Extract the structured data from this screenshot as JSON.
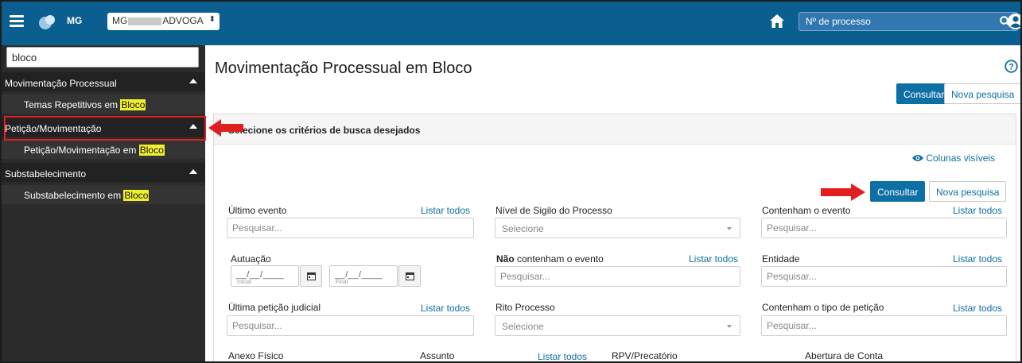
{
  "header": {
    "state": "MG",
    "user_select": {
      "prefix": "MG",
      "suffix": "ADVOGA"
    },
    "process_search_placeholder": "Nº de processo"
  },
  "sidebar": {
    "search_value": "bloco",
    "groups": [
      {
        "label": "Movimentação Processual",
        "items": [
          {
            "text": "Temas Repetitivos em ",
            "highlight": "Bloco"
          }
        ]
      },
      {
        "label": "Petição/Movimentação",
        "items": [
          {
            "text": "Petição/Movimentação em ",
            "highlight": "Bloco"
          }
        ]
      },
      {
        "label": "Substabelecimento",
        "items": [
          {
            "text": "Substabelecimento em ",
            "highlight": "Bloco"
          }
        ]
      }
    ]
  },
  "main": {
    "title": "Movimentação Processual em Bloco",
    "consultar": "Consultar",
    "nova_pesquisa": "Nova pesquisa",
    "card_header": "Selecione os critérios de busca desejados",
    "colunas_visiveis": "Colunas visíveis",
    "listar_todos": "Listar todos",
    "pesquisar_placeholder": "Pesquisar...",
    "selecione": "Selecione",
    "fields": {
      "ultimo_evento": "Último evento",
      "nivel_sigilo": "Nível de Sigilo do Processo",
      "contenham_evento": "Contenham o evento",
      "autuacao": "Autuação",
      "nao_bold": "Não",
      "nao_rest": " contenham o evento",
      "entidade": "Entidade",
      "ultima_peticao": "Última petição judicial",
      "rito_processo": "Rito Processo",
      "contenham_tipo_peticao": "Contenham o tipo de petição",
      "anexo_fisico": "Anexo Físico",
      "assunto": "Assunto",
      "rpv": "RPV/Precatório",
      "abertura_conta": "Abertura de Conta"
    },
    "date_mask": "__/__/____",
    "date_inicial": "Inicial",
    "date_final": "Final"
  },
  "colors": {
    "topbar": "#0b5f90",
    "primary": "#0d6fa3",
    "sidebar": "#2b2b2b",
    "highlight": "#f1f12a",
    "annotation": "#e02020"
  },
  "icons": [
    "menu-icon",
    "logo-icon",
    "home-icon",
    "search-icon",
    "user-icon",
    "help-icon",
    "eye-icon",
    "calendar-icon",
    "caret-up-icon",
    "arrow-right-icon"
  ]
}
